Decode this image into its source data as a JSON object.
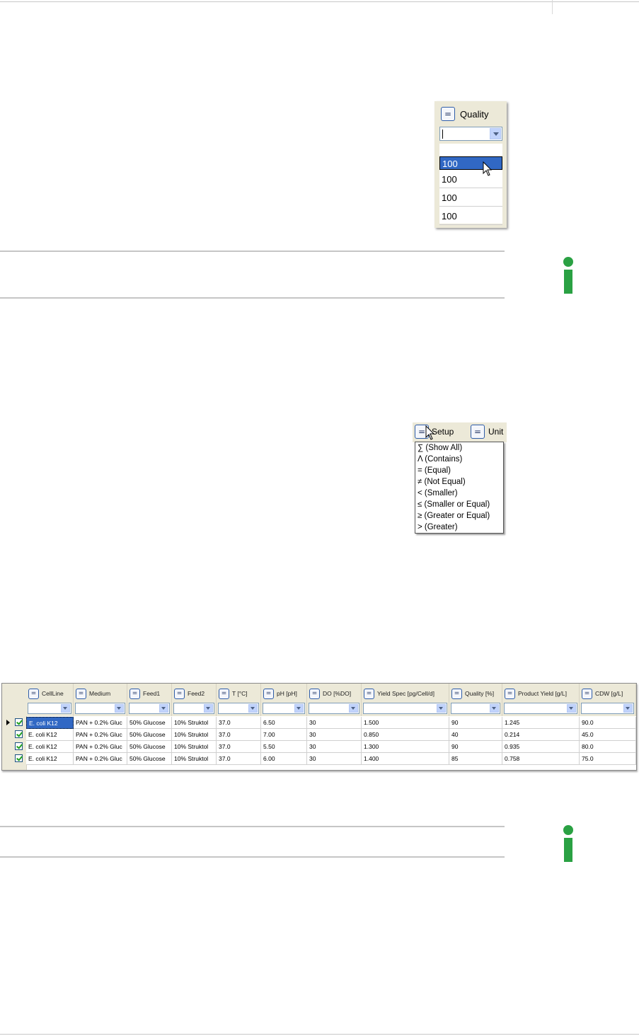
{
  "quality_filter": {
    "header_label": "Quality",
    "eq_symbol": "=",
    "input_value": "",
    "options": [
      "",
      "100",
      "100",
      "100",
      "100"
    ],
    "selected_index": 1
  },
  "setup_filter": {
    "eq_symbol": "=",
    "columns": [
      "Setup",
      "Unit"
    ],
    "menu_items": [
      "∑ (Show All)",
      "Λ (Contains)",
      "= (Equal)",
      "≠ (Not Equal)",
      "< (Smaller)",
      "≤ (Smaller or Equal)",
      "≥ (Greater or Equal)",
      "> (Greater)"
    ]
  },
  "grid": {
    "eq_symbol": "=",
    "columns": [
      "CellLine",
      "Medium",
      "Feed1",
      "Feed2",
      "T [°C]",
      "pH [pH]",
      "DO [%DO]",
      "Yield Spec [pg/Cell/d]",
      "Quality [%]",
      "Product Yield [g/L]",
      "CDW [g/L]"
    ],
    "rows": [
      [
        "E. coli K12",
        "PAN + 0.2% Gluc",
        "50% Glucose",
        "10% Struktol",
        "37.0",
        "6.50",
        "30",
        "1.500",
        "90",
        "1.245",
        "90.0"
      ],
      [
        "E. coli K12",
        "PAN + 0.2% Gluc",
        "50% Glucose",
        "10% Struktol",
        "37.0",
        "7.00",
        "30",
        "0.850",
        "40",
        "0.214",
        "45.0"
      ],
      [
        "E. coli K12",
        "PAN + 0.2% Gluc",
        "50% Glucose",
        "10% Struktol",
        "37.0",
        "5.50",
        "30",
        "1.300",
        "90",
        "0.935",
        "80.0"
      ],
      [
        "E. coli K12",
        "PAN + 0.2% Gluc",
        "50% Glucose",
        "10% Struktol",
        "37.0",
        "6.00",
        "30",
        "1.400",
        "85",
        "0.758",
        "75.0"
      ]
    ],
    "checked": [
      true,
      true,
      true,
      true
    ],
    "current_row": 0
  },
  "colors": {
    "info_green": "#2aa143",
    "selection_blue": "#3168c4",
    "panel_bg": "#ece9d8"
  },
  "icons": [
    "info-icon",
    "mouse-pointer-icon",
    "dropdown-arrow-icon",
    "checkbox-checked-icon",
    "row-indicator-icon"
  ]
}
